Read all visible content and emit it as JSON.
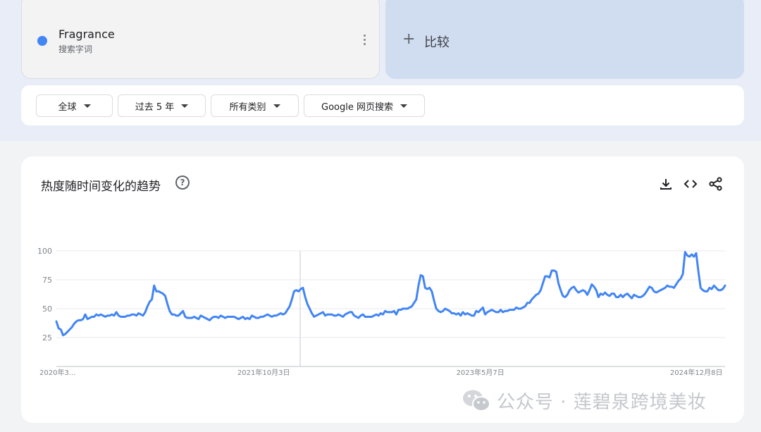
{
  "search_term": {
    "name": "Fragrance",
    "subtitle": "搜索字词",
    "color": "#4285f4"
  },
  "compare": {
    "plus": "+",
    "label": "比较"
  },
  "filters": [
    {
      "label": "全球"
    },
    {
      "label": "过去 5 年"
    },
    {
      "label": "所有类别"
    },
    {
      "label": "Google 网页搜索"
    }
  ],
  "chart_section": {
    "title": "热度随时间变化的趋势",
    "help": "?",
    "tools": [
      "download-icon",
      "embed-code-icon",
      "share-icon"
    ]
  },
  "chart_data": {
    "type": "line",
    "series_color": "#4285f4",
    "ylim": [
      0,
      100
    ],
    "yticks": [
      "100",
      "75",
      "50",
      "25"
    ],
    "xtick_labels": [
      "2020年3...",
      "2021年10月3日",
      "2023年5月7日",
      "2024年12月8日"
    ],
    "hover_marker_label": "2021年10月3日",
    "x_start": "2020-03",
    "x_end": "2025-03",
    "values": [
      39,
      33,
      32,
      27,
      28,
      30,
      32,
      34,
      37,
      39,
      40,
      40,
      41,
      45,
      41,
      42,
      43,
      43,
      45,
      44,
      45,
      44,
      43,
      44,
      44,
      45,
      44,
      47,
      44,
      43,
      43,
      43,
      44,
      44,
      45,
      45,
      44,
      46,
      45,
      44,
      47,
      52,
      56,
      58,
      70,
      65,
      65,
      64,
      63,
      61,
      54,
      48,
      45,
      45,
      44,
      44,
      46,
      48,
      43,
      42,
      42,
      42,
      43,
      42,
      41,
      44,
      43,
      42,
      41,
      40,
      42,
      43,
      43,
      42,
      44,
      43,
      42,
      43,
      43,
      43,
      43,
      42,
      41,
      42,
      43,
      41,
      42,
      41,
      44,
      43,
      42,
      42,
      43,
      43,
      44,
      45,
      44,
      43,
      44,
      44,
      45,
      46,
      45,
      46,
      49,
      52,
      58,
      65,
      66,
      65,
      67,
      68,
      60,
      54,
      50,
      46,
      43,
      44,
      45,
      46,
      47,
      44,
      45,
      45,
      45,
      44,
      44,
      45,
      44,
      43,
      45,
      46,
      47,
      47,
      44,
      43,
      42,
      44,
      45,
      43,
      43,
      43,
      43,
      44,
      45,
      44,
      46,
      45,
      48,
      47,
      47,
      47,
      48,
      45,
      49,
      49,
      50,
      50,
      50,
      51,
      52,
      55,
      58,
      70,
      79,
      78,
      68,
      67,
      68,
      65,
      57,
      50,
      48,
      47,
      48,
      50,
      49,
      48,
      46,
      46,
      45,
      46,
      44,
      47,
      45,
      46,
      45,
      44,
      44,
      48,
      47,
      49,
      51,
      45,
      47,
      48,
      49,
      48,
      47,
      47,
      49,
      47,
      48,
      48,
      49,
      49,
      49,
      51,
      50,
      50,
      51,
      52,
      55,
      55,
      58,
      60,
      62,
      63,
      66,
      72,
      78,
      78,
      77,
      83,
      83,
      82,
      72,
      66,
      61,
      60,
      62,
      66,
      68,
      69,
      66,
      64,
      65,
      66,
      65,
      62,
      66,
      71,
      69,
      66,
      60,
      63,
      62,
      64,
      62,
      61,
      63,
      63,
      60,
      60,
      62,
      60,
      62,
      63,
      61,
      59,
      62,
      61,
      60,
      60,
      61,
      63,
      66,
      69,
      68,
      65,
      64,
      65,
      66,
      67,
      68,
      70,
      69,
      69,
      68,
      71,
      74,
      76,
      80,
      99,
      96,
      95,
      97,
      95,
      98,
      82,
      68,
      66,
      65,
      65,
      68,
      67,
      70,
      68,
      66,
      66,
      67,
      70
    ]
  },
  "watermark": {
    "text": "公众号 · 莲碧泉跨境美妆"
  }
}
